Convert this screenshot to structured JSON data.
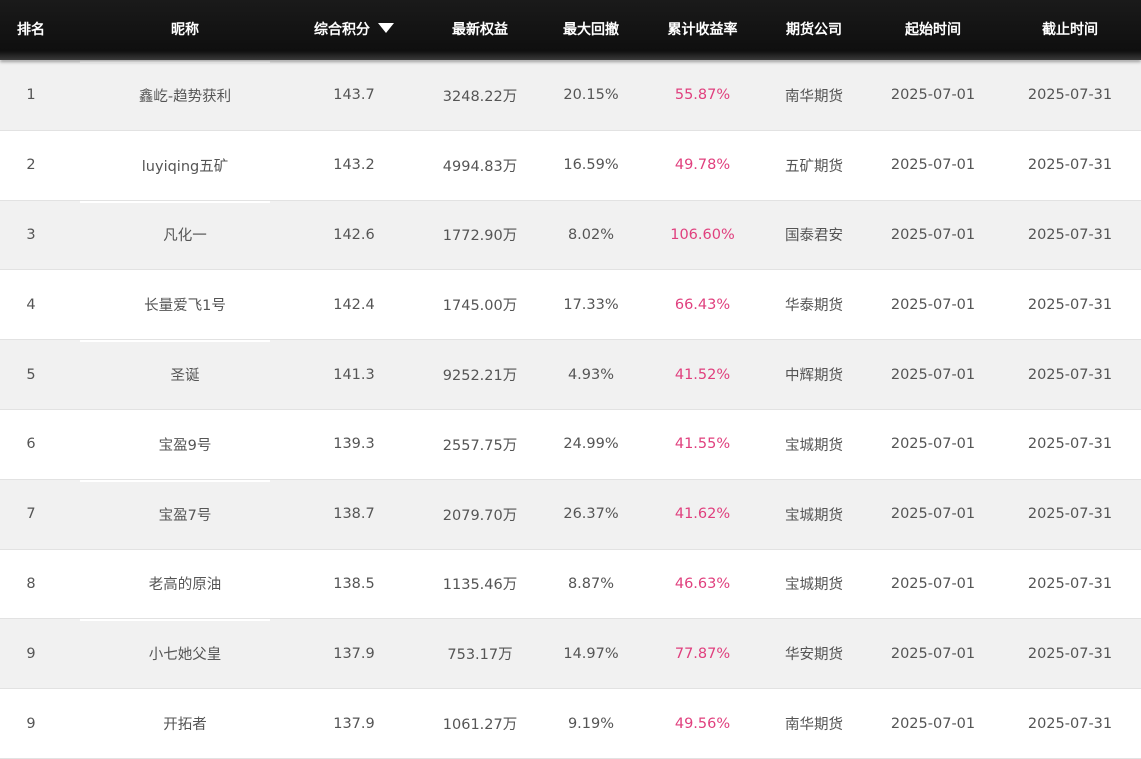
{
  "header": {
    "rank": "排名",
    "name": "昵称",
    "score": "综合积分",
    "equity": "最新权益",
    "drawdown": "最大回撤",
    "return": "累计收益率",
    "company": "期货公司",
    "start": "起始时间",
    "end": "截止时间",
    "sort_icon": "caret-down-icon"
  },
  "colors": {
    "header_bg": "#111111",
    "return_text": "#e0407e",
    "row_alt": "#f1f1f1"
  },
  "rows": [
    {
      "rank": "1",
      "name": "鑫屹-趋势获利",
      "score": "143.7",
      "equity": "3248.22万",
      "drawdown": "20.15%",
      "return": "55.87%",
      "company": "南华期货",
      "start": "2025-07-01",
      "end": "2025-07-31"
    },
    {
      "rank": "2",
      "name": "luyiqing五矿",
      "score": "143.2",
      "equity": "4994.83万",
      "drawdown": "16.59%",
      "return": "49.78%",
      "company": "五矿期货",
      "start": "2025-07-01",
      "end": "2025-07-31"
    },
    {
      "rank": "3",
      "name": "凡化一",
      "score": "142.6",
      "equity": "1772.90万",
      "drawdown": "8.02%",
      "return": "106.60%",
      "company": "国泰君安",
      "start": "2025-07-01",
      "end": "2025-07-31"
    },
    {
      "rank": "4",
      "name": "长量爱飞1号",
      "score": "142.4",
      "equity": "1745.00万",
      "drawdown": "17.33%",
      "return": "66.43%",
      "company": "华泰期货",
      "start": "2025-07-01",
      "end": "2025-07-31"
    },
    {
      "rank": "5",
      "name": "圣诞",
      "score": "141.3",
      "equity": "9252.21万",
      "drawdown": "4.93%",
      "return": "41.52%",
      "company": "中辉期货",
      "start": "2025-07-01",
      "end": "2025-07-31"
    },
    {
      "rank": "6",
      "name": "宝盈9号",
      "score": "139.3",
      "equity": "2557.75万",
      "drawdown": "24.99%",
      "return": "41.55%",
      "company": "宝城期货",
      "start": "2025-07-01",
      "end": "2025-07-31"
    },
    {
      "rank": "7",
      "name": "宝盈7号",
      "score": "138.7",
      "equity": "2079.70万",
      "drawdown": "26.37%",
      "return": "41.62%",
      "company": "宝城期货",
      "start": "2025-07-01",
      "end": "2025-07-31"
    },
    {
      "rank": "8",
      "name": "老高的原油",
      "score": "138.5",
      "equity": "1135.46万",
      "drawdown": "8.87%",
      "return": "46.63%",
      "company": "宝城期货",
      "start": "2025-07-01",
      "end": "2025-07-31"
    },
    {
      "rank": "9",
      "name": "小七她父皇",
      "score": "137.9",
      "equity": "753.17万",
      "drawdown": "14.97%",
      "return": "77.87%",
      "company": "华安期货",
      "start": "2025-07-01",
      "end": "2025-07-31"
    },
    {
      "rank": "9",
      "name": "开拓者",
      "score": "137.9",
      "equity": "1061.27万",
      "drawdown": "9.19%",
      "return": "49.56%",
      "company": "南华期货",
      "start": "2025-07-01",
      "end": "2025-07-31"
    }
  ]
}
